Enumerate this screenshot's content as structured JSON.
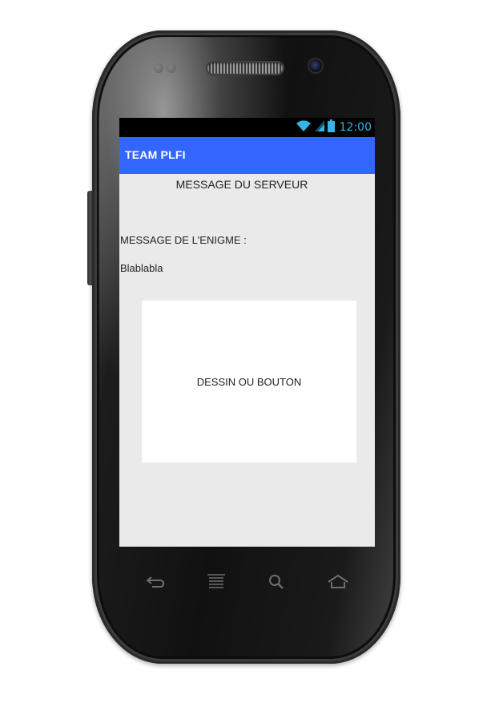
{
  "status_bar": {
    "time": "12:00",
    "icons": [
      "wifi-icon",
      "signal-icon",
      "battery-icon"
    ],
    "time_color": "#33b5e5"
  },
  "action_bar": {
    "title": "TEAM PLFI",
    "color": "#3366ff"
  },
  "content": {
    "server_message": "MESSAGE DU SERVEUR",
    "enigma_label": "MESSAGE DE L'ENIGME :",
    "enigma_text": "Blablabla",
    "drawing_area_label": "DESSIN OU BOUTON"
  },
  "nav_bar": {
    "buttons": [
      "back-icon",
      "menu-icon",
      "search-icon",
      "home-icon"
    ]
  }
}
